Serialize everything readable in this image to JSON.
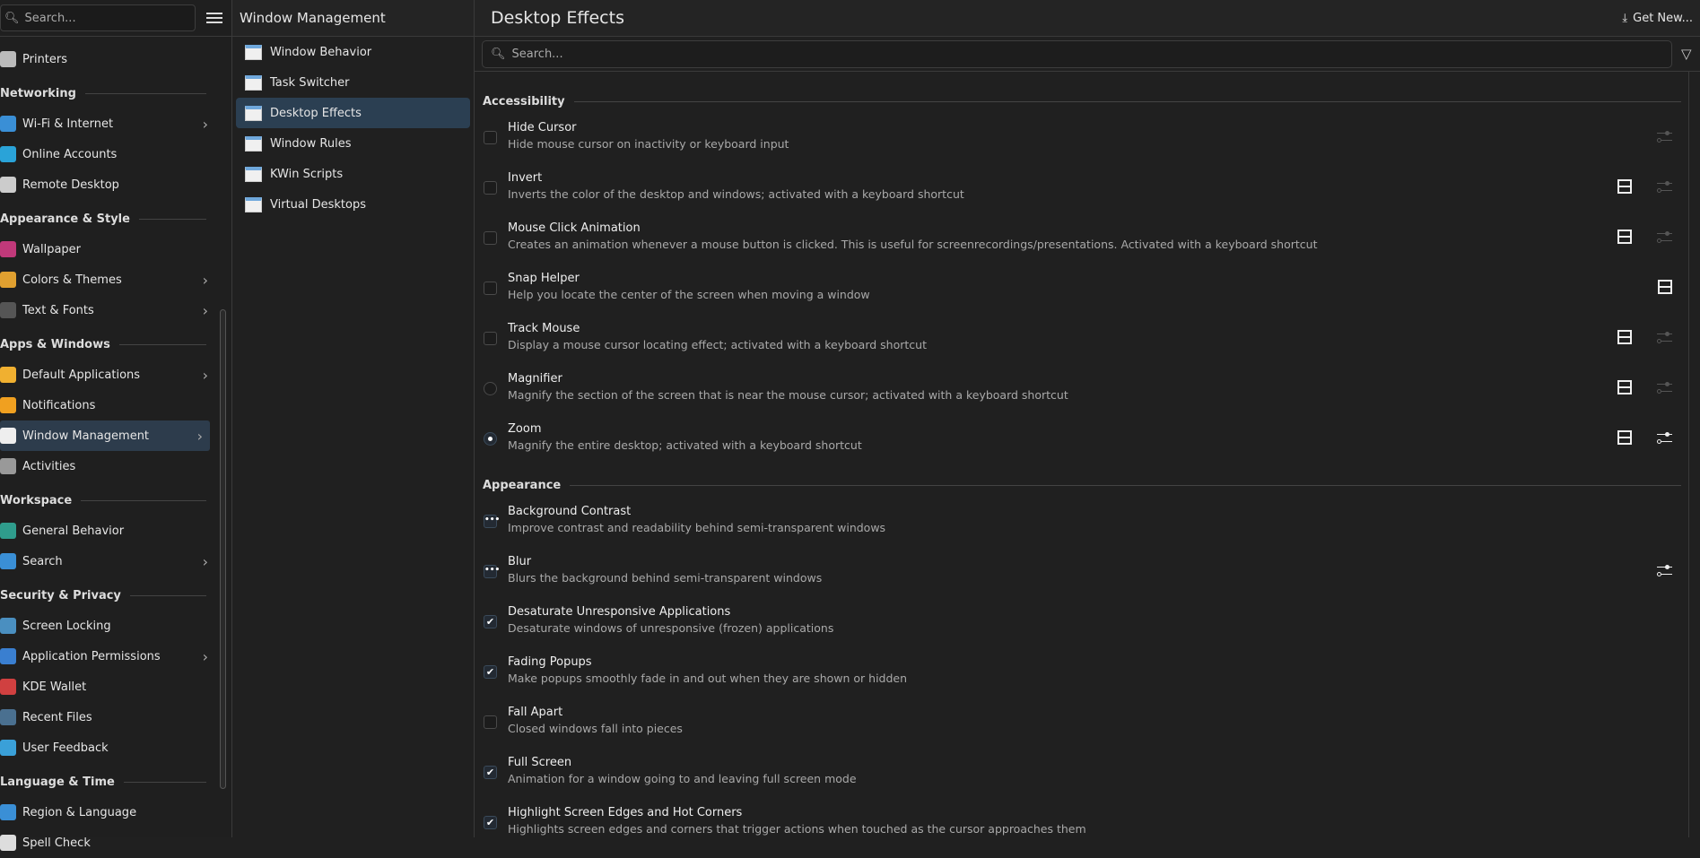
{
  "sidebar": {
    "search_placeholder": "Search...",
    "items": [
      {
        "type": "item",
        "label": "Printers",
        "color": "#bbbbbb"
      },
      {
        "type": "header",
        "label": "Networking"
      },
      {
        "type": "item",
        "label": "Wi-Fi & Internet",
        "color": "#3a8fd6",
        "chevron": true
      },
      {
        "type": "item",
        "label": "Online Accounts",
        "color": "#2aa3d8"
      },
      {
        "type": "item",
        "label": "Remote Desktop",
        "color": "#cccccc"
      },
      {
        "type": "header",
        "label": "Appearance & Style"
      },
      {
        "type": "item",
        "label": "Wallpaper",
        "color": "#c0397a"
      },
      {
        "type": "item",
        "label": "Colors & Themes",
        "color": "#e0a030",
        "chevron": true
      },
      {
        "type": "item",
        "label": "Text & Fonts",
        "color": "#555555",
        "chevron": true
      },
      {
        "type": "header",
        "label": "Apps & Windows"
      },
      {
        "type": "item",
        "label": "Default Applications",
        "color": "#f0b030",
        "chevron": true
      },
      {
        "type": "item",
        "label": "Notifications",
        "color": "#f0a020"
      },
      {
        "type": "item",
        "label": "Window Management",
        "color": "#eeeeee",
        "chevron": true,
        "selected": true
      },
      {
        "type": "item",
        "label": "Activities",
        "color": "#999999"
      },
      {
        "type": "header",
        "label": "Workspace"
      },
      {
        "type": "item",
        "label": "General Behavior",
        "color": "#2f9c8c"
      },
      {
        "type": "item",
        "label": "Search",
        "color": "#3a8fd6",
        "chevron": true
      },
      {
        "type": "header",
        "label": "Security & Privacy"
      },
      {
        "type": "item",
        "label": "Screen Locking",
        "color": "#4a8fc0"
      },
      {
        "type": "item",
        "label": "Application Permissions",
        "color": "#3a7fd0",
        "chevron": true
      },
      {
        "type": "item",
        "label": "KDE Wallet",
        "color": "#d04040"
      },
      {
        "type": "item",
        "label": "Recent Files",
        "color": "#4a7090"
      },
      {
        "type": "item",
        "label": "User Feedback",
        "color": "#3aa0d8"
      },
      {
        "type": "header",
        "label": "Language & Time"
      },
      {
        "type": "item",
        "label": "Region & Language",
        "color": "#3a8fd6"
      },
      {
        "type": "item",
        "label": "Spell Check",
        "color": "#dddddd"
      }
    ]
  },
  "middle": {
    "title": "Window Management",
    "items": [
      {
        "label": "Window Behavior"
      },
      {
        "label": "Task Switcher"
      },
      {
        "label": "Desktop Effects",
        "selected": true
      },
      {
        "label": "Window Rules"
      },
      {
        "label": "KWin Scripts"
      },
      {
        "label": "Virtual Desktops"
      }
    ]
  },
  "main": {
    "title": "Desktop Effects",
    "get_new": "Get New...",
    "search_placeholder": "Search...",
    "categories": [
      {
        "name": "Accessibility",
        "effects": [
          {
            "title": "Hide Cursor",
            "desc": "Hide mouse cursor on inactivity or keyboard input",
            "state": "off",
            "kind": "check",
            "video": false,
            "config": "disabled"
          },
          {
            "title": "Invert",
            "desc": "Inverts the color of the desktop and windows; activated with a keyboard shortcut",
            "state": "off",
            "kind": "check",
            "video": true,
            "config": "disabled"
          },
          {
            "title": "Mouse Click Animation",
            "desc": "Creates an animation whenever a mouse button is clicked. This is useful for screenrecordings/presentations. Activated with a keyboard shortcut",
            "state": "off",
            "kind": "check",
            "video": true,
            "config": "disabled"
          },
          {
            "title": "Snap Helper",
            "desc": "Help you locate the center of the screen when moving a window",
            "state": "off",
            "kind": "check",
            "video": true,
            "config": "none"
          },
          {
            "title": "Track Mouse",
            "desc": "Display a mouse cursor locating effect; activated with a keyboard shortcut",
            "state": "off",
            "kind": "check",
            "video": true,
            "config": "disabled"
          },
          {
            "title": "Magnifier",
            "desc": "Magnify the section of the screen that is near the mouse cursor; activated with a keyboard shortcut",
            "state": "off",
            "kind": "radio",
            "video": true,
            "config": "disabled"
          },
          {
            "title": "Zoom",
            "desc": "Magnify the entire desktop; activated with a keyboard shortcut",
            "state": "on",
            "kind": "radio",
            "video": true,
            "config": "enabled"
          }
        ]
      },
      {
        "name": "Appearance",
        "effects": [
          {
            "title": "Background Contrast",
            "desc": "Improve contrast and readability behind semi-transparent windows",
            "state": "default",
            "kind": "multi",
            "video": false,
            "config": "none"
          },
          {
            "title": "Blur",
            "desc": "Blurs the background behind semi-transparent windows",
            "state": "default",
            "kind": "multi",
            "video": false,
            "config": "enabled"
          },
          {
            "title": "Desaturate Unresponsive Applications",
            "desc": "Desaturate windows of unresponsive (frozen) applications",
            "state": "on",
            "kind": "check",
            "video": false,
            "config": "none"
          },
          {
            "title": "Fading Popups",
            "desc": "Make popups smoothly fade in and out when they are shown or hidden",
            "state": "on",
            "kind": "check",
            "video": false,
            "config": "none"
          },
          {
            "title": "Fall Apart",
            "desc": "Closed windows fall into pieces",
            "state": "off",
            "kind": "check",
            "video": false,
            "config": "none"
          },
          {
            "title": "Full Screen",
            "desc": "Animation for a window going to and leaving full screen mode",
            "state": "on",
            "kind": "check",
            "video": false,
            "config": "none"
          },
          {
            "title": "Highlight Screen Edges and Hot Corners",
            "desc": "Highlights screen edges and corners that trigger actions when touched as the cursor approaches them",
            "state": "on",
            "kind": "check",
            "video": false,
            "config": "none"
          }
        ]
      }
    ]
  }
}
